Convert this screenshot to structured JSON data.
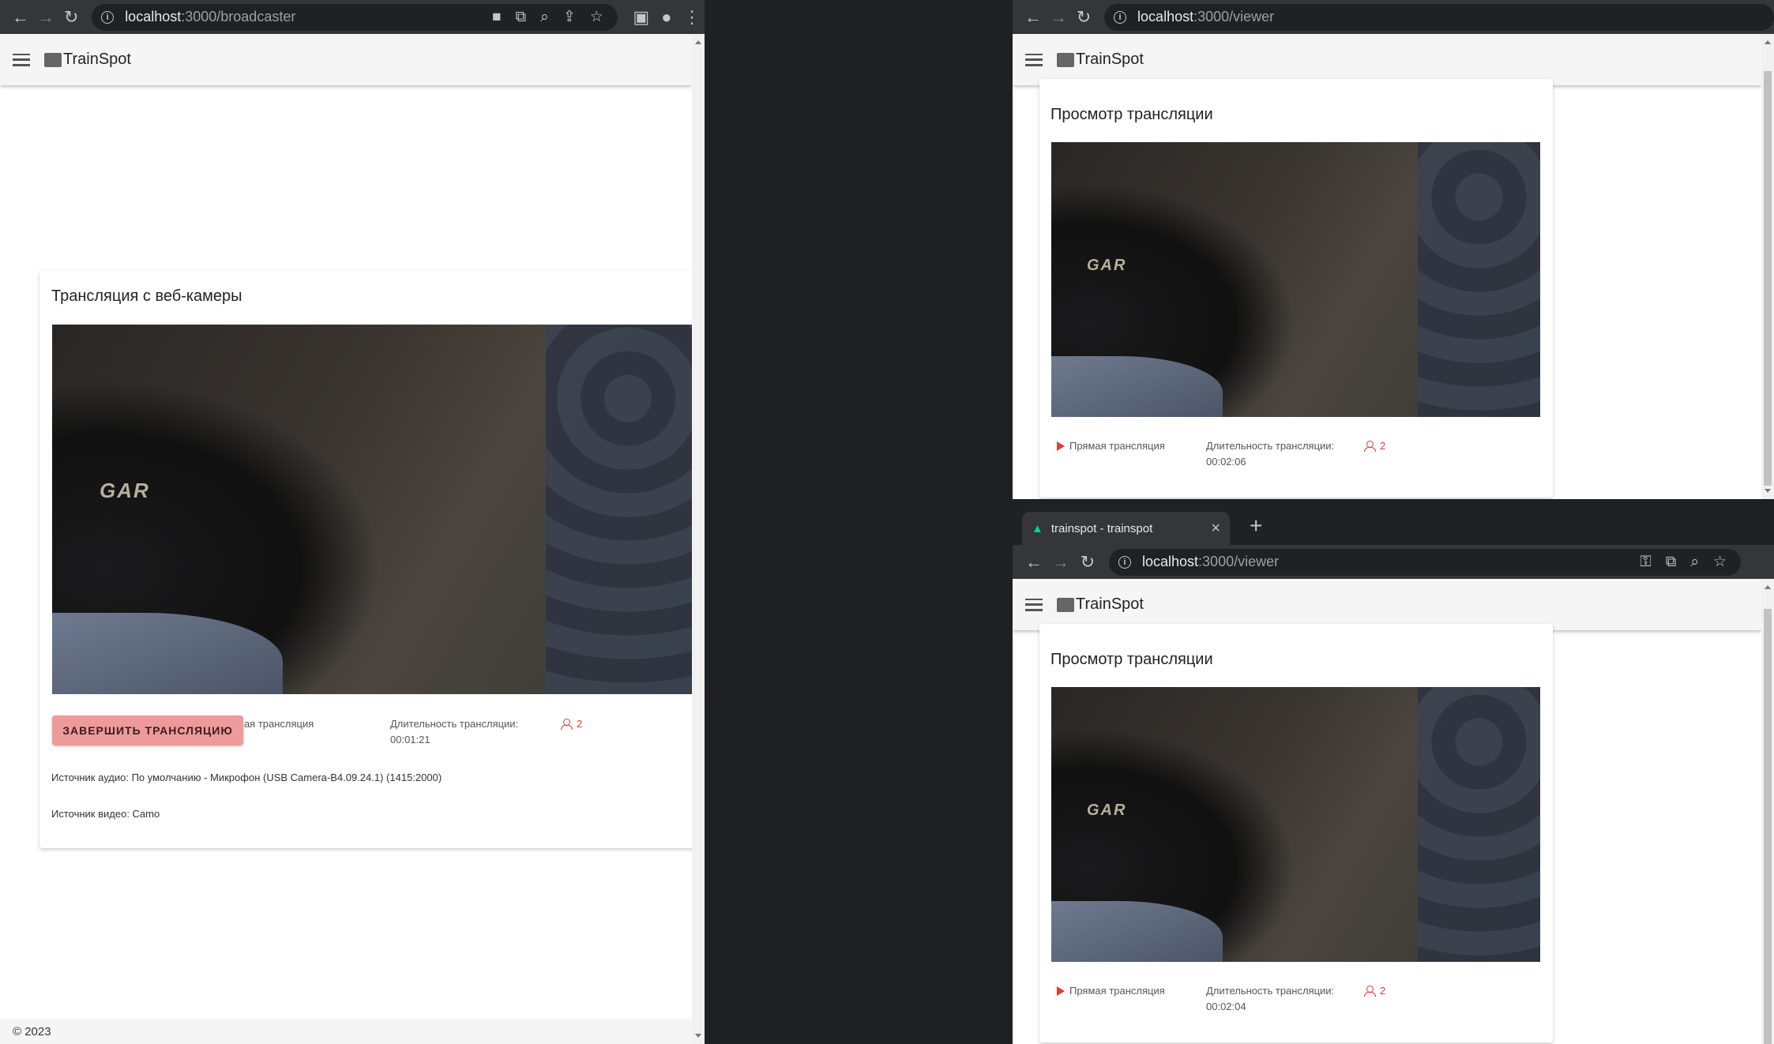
{
  "left_window": {
    "url_host": "localhost",
    "url_path": ":3000/broadcaster",
    "brand": "TrainSpot",
    "card_title": "Трансляция с веб-камеры",
    "video_text": "GAR",
    "end_button": "ЗАВЕРШИТЬ ТРАНСЛЯЦИЮ",
    "live_label_partial": "мая трансляция",
    "duration_label": "Длительность трансляции:",
    "duration_value": "00:01:21",
    "viewer_count": "2",
    "audio_source": "Источник аудио: По умолчанию - Микрофон (USB Camera-B4.09.24.1) (1415:2000)",
    "video_source": "Источник видео: Camo",
    "footer": "© 2023"
  },
  "top_right_window": {
    "url_host": "localhost",
    "url_path": ":3000/viewer",
    "brand": "TrainSpot",
    "card_title": "Просмотр трансляции",
    "video_text": "GAR",
    "live_label": "Прямая трансляция",
    "duration_label": "Длительность трансляции:",
    "duration_value": "00:02:06",
    "viewer_count": "2"
  },
  "bottom_right_window": {
    "tab_title": "trainspot - trainspot",
    "url_host": "localhost",
    "url_path": ":3000/viewer",
    "brand": "TrainSpot",
    "card_title": "Просмотр трансляции",
    "video_text": "GAR",
    "live_label": "Прямая трансляция",
    "duration_label": "Длительность трансляции:",
    "duration_value": "00:02:04",
    "viewer_count": "2"
  },
  "icons": {
    "back": "back-arrow-icon",
    "forward": "forward-arrow-icon",
    "reload": "reload-icon",
    "info": "info-icon",
    "camera": "camera-icon",
    "translate": "translate-icon",
    "zoom": "zoom-icon",
    "share": "share-icon",
    "star": "star-icon",
    "sidebar": "side-panel-icon",
    "profile": "profile-icon",
    "menu": "kebab-menu-icon",
    "key": "key-icon"
  },
  "colors": {
    "accent_red": "#e53935",
    "button_pink": "#ef9a9a",
    "chrome_dark": "#35363a"
  }
}
